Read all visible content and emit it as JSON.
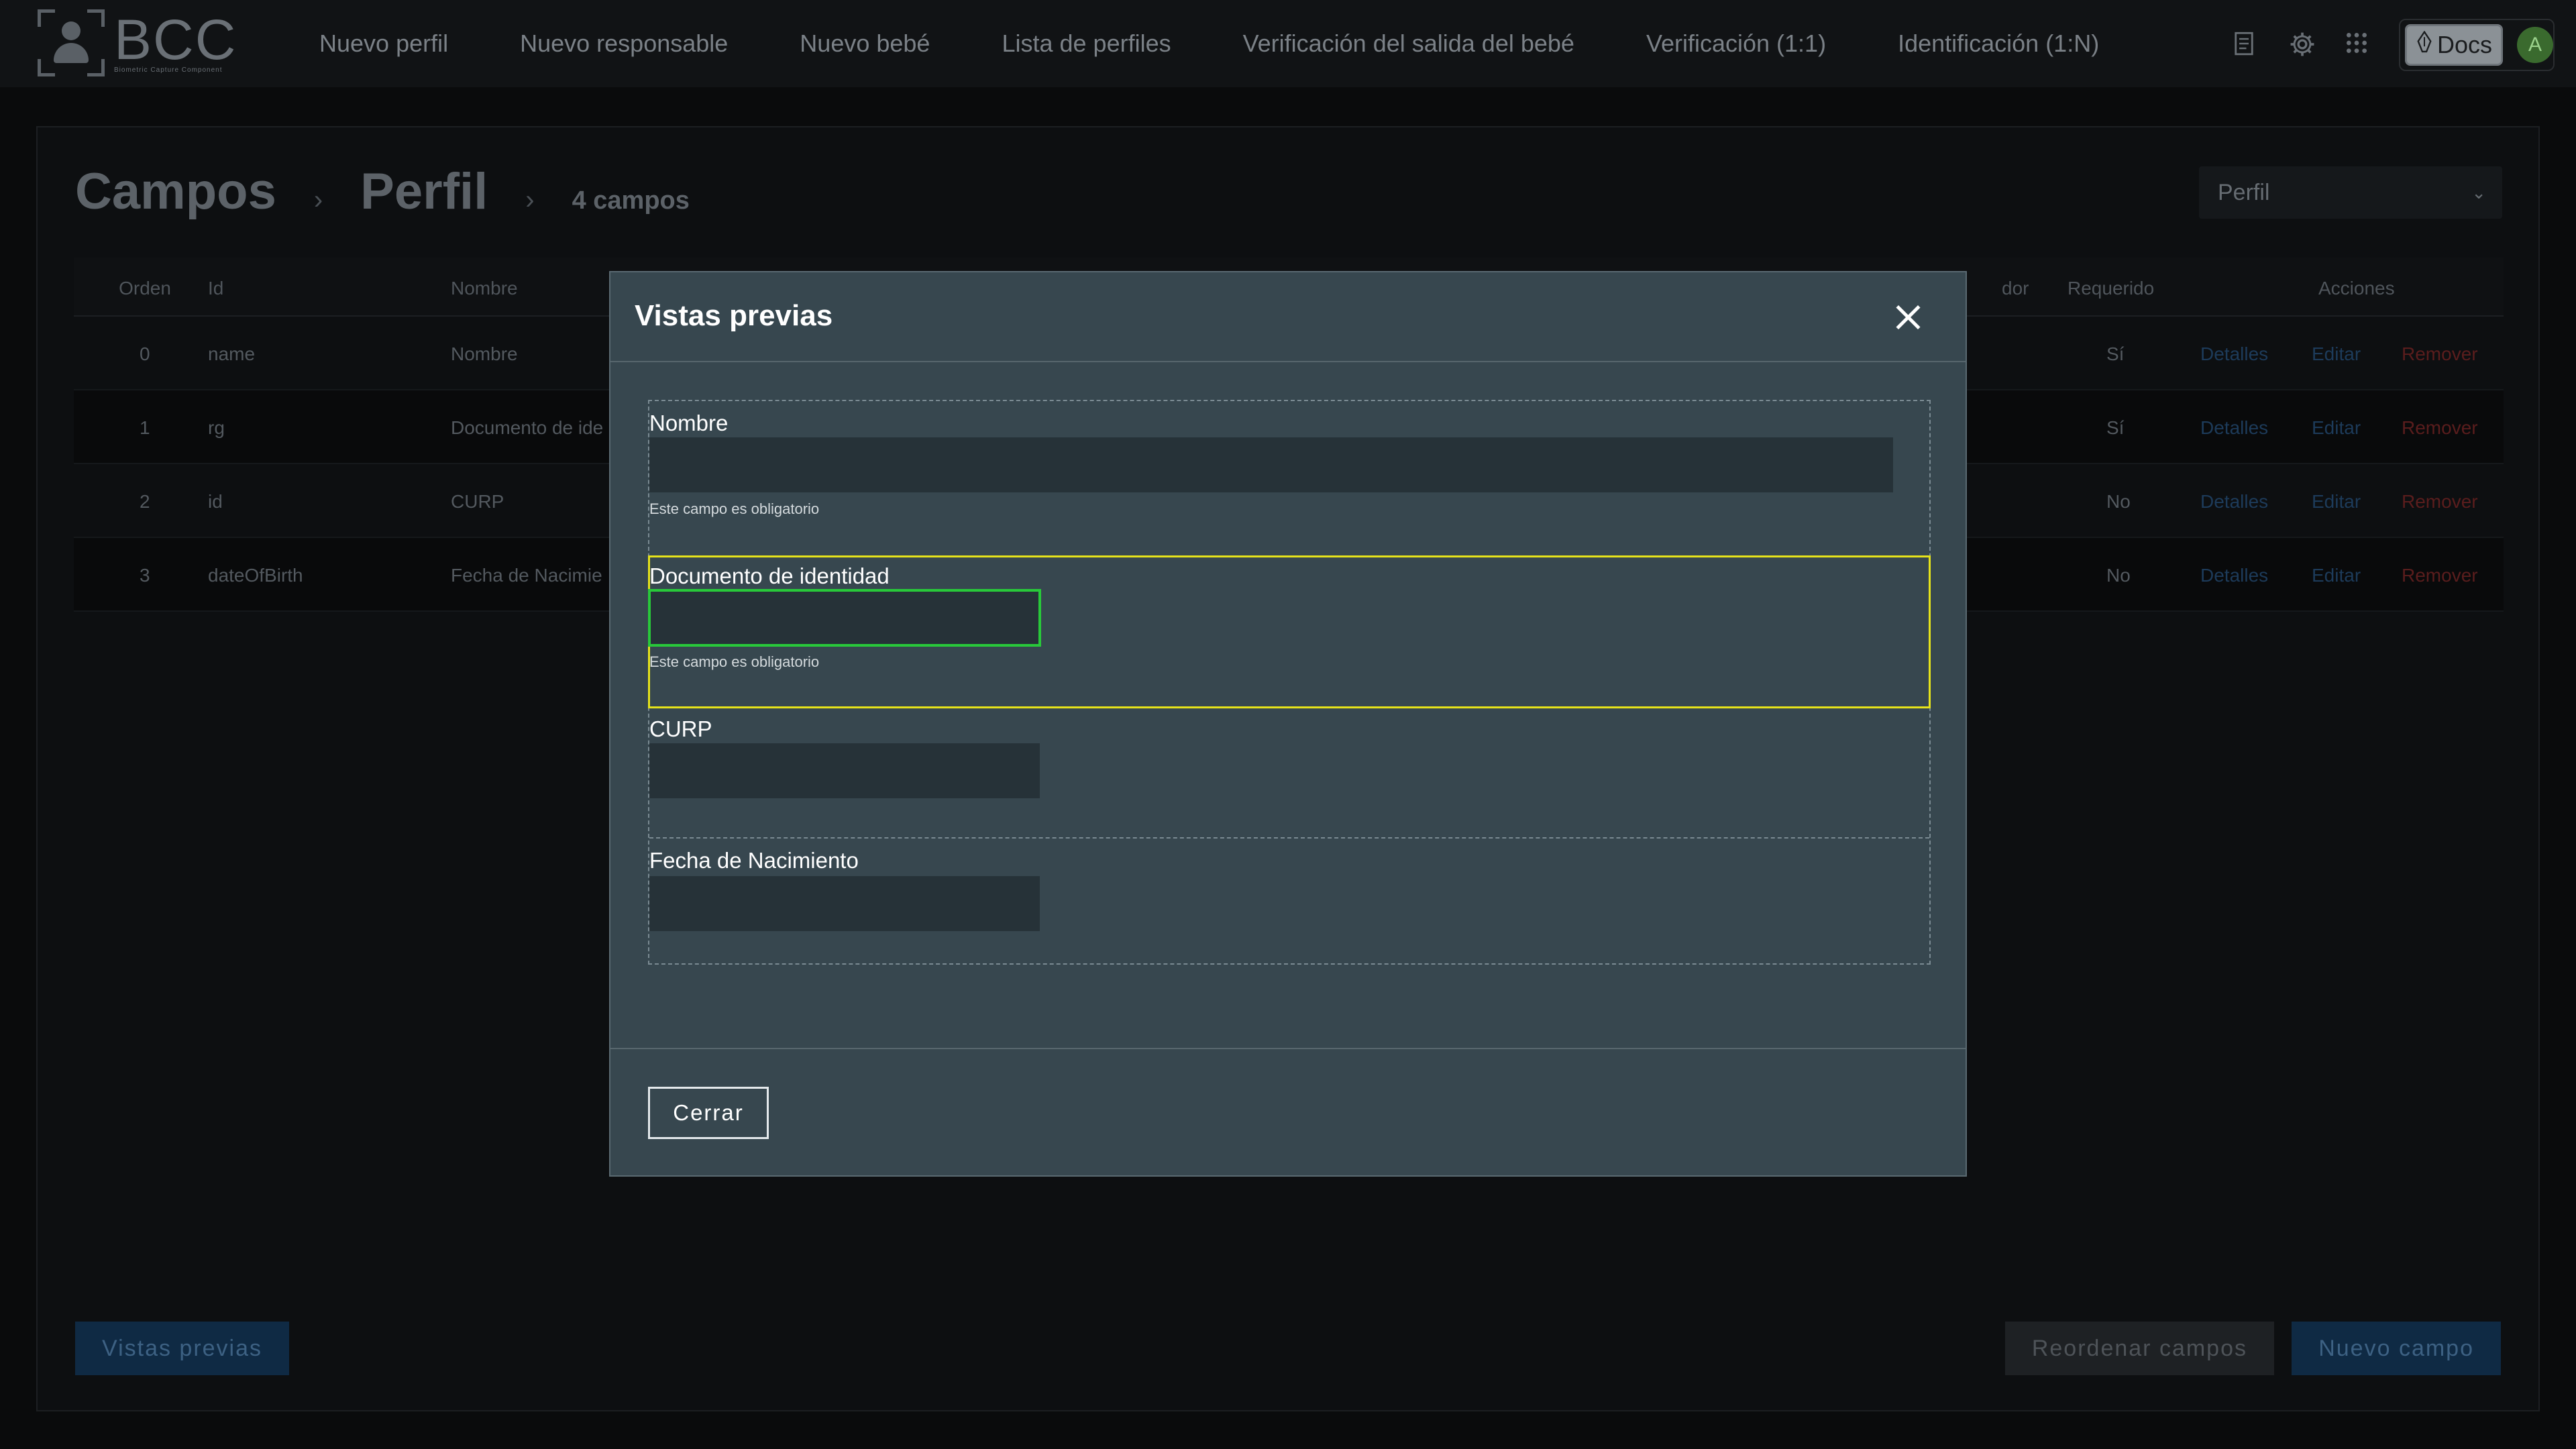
{
  "nav": {
    "logo_text": "BCC",
    "logo_subtitle": "Biometric Capture Component",
    "items": [
      "Nuevo perfil",
      "Nuevo responsable",
      "Nuevo bebé",
      "Lista de perfiles",
      "Verificación del salida del bebé",
      "Verificación (1:1)",
      "Identificación (1:N)"
    ],
    "docs_label": "Docs",
    "avatar_initial": "A"
  },
  "page": {
    "breadcrumb": [
      "Campos",
      "Perfil",
      "4 campos"
    ],
    "select_value": "Perfil",
    "table": {
      "headers": [
        "Orden",
        "Id",
        "Nombre",
        "dor",
        "Requerido",
        "Acciones"
      ],
      "rows": [
        {
          "orden": "0",
          "id": "name",
          "nombre": "Nombre",
          "requerido": "Sí"
        },
        {
          "orden": "1",
          "id": "rg",
          "nombre": "Documento de ide",
          "requerido": "Sí"
        },
        {
          "orden": "2",
          "id": "id",
          "nombre": "CURP",
          "requerido": "No"
        },
        {
          "orden": "3",
          "id": "dateOfBirth",
          "nombre": "Fecha de Nacimie",
          "requerido": "No"
        }
      ],
      "actions": [
        "Detalles",
        "Editar",
        "Remover"
      ]
    },
    "buttons": {
      "preview": "Vistas previas",
      "reorder": "Reordenar campos",
      "new_field": "Nuevo campo"
    }
  },
  "modal": {
    "title": "Vistas previas",
    "fields": [
      {
        "label": "Nombre",
        "value": "",
        "hint": "Este campo es obligatorio"
      },
      {
        "label": "Documento de identidad",
        "value": "",
        "hint": "Este campo es obligatorio"
      },
      {
        "label": "CURP",
        "value": ""
      },
      {
        "label": "Fecha de Nacimiento",
        "value": ""
      }
    ],
    "close_label": "Cerrar"
  },
  "colors": {
    "modal_bg": "#37474f",
    "input_bg": "#263238",
    "highlight": "#e6e31a",
    "focus": "#28c93a",
    "primary": "#0f2a44",
    "danger": "#5a1d1d"
  }
}
